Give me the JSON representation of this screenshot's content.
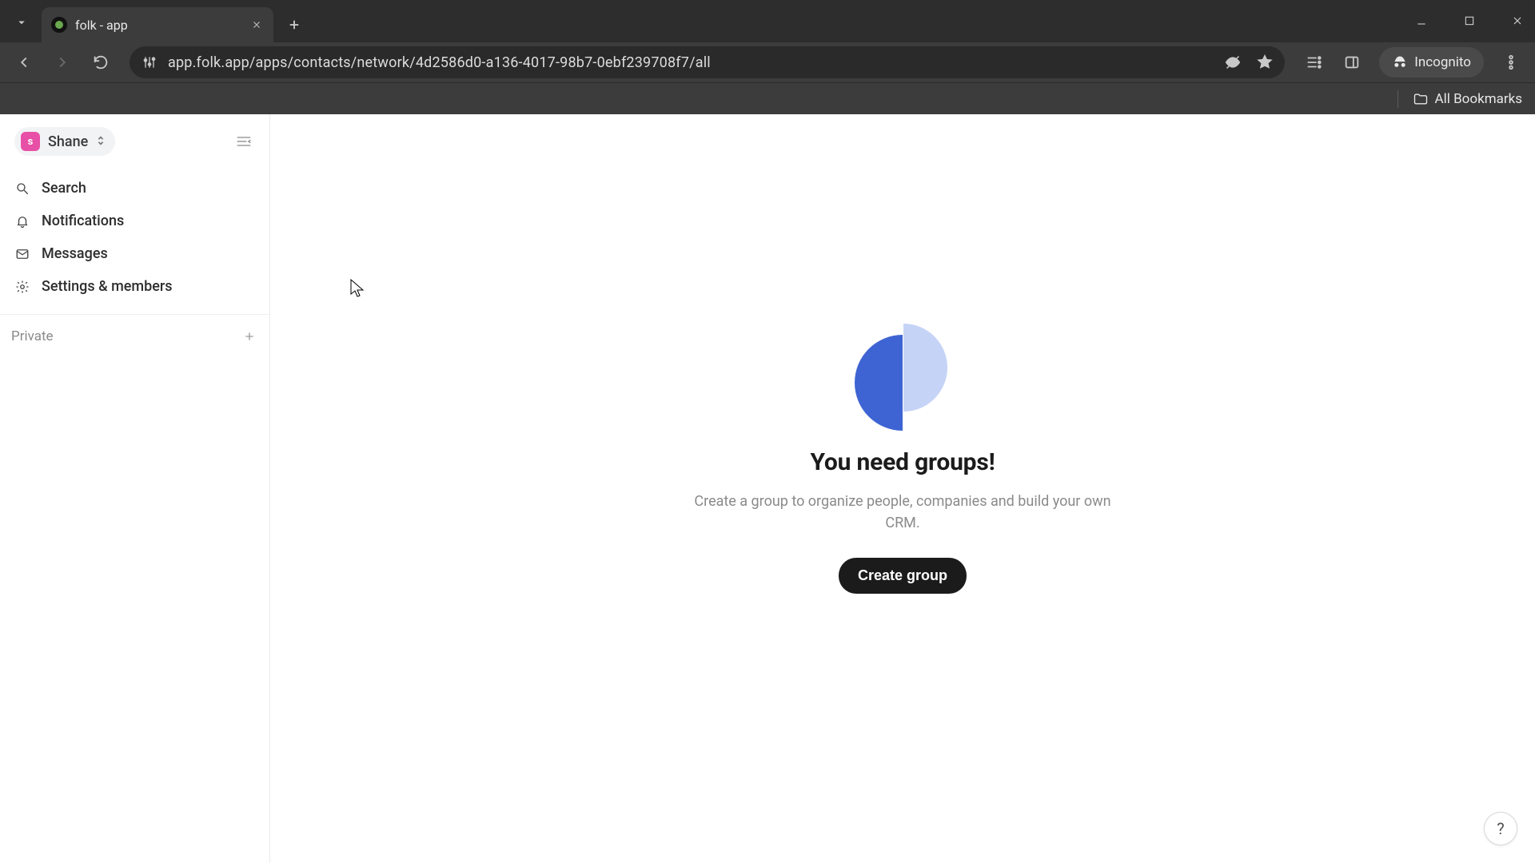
{
  "browser": {
    "tab_title": "folk - app",
    "url": "app.folk.app/apps/contacts/network/4d2586d0-a136-4017-98b7-0ebf239708f7/all",
    "incognito_label": "Incognito",
    "all_bookmarks_label": "All Bookmarks"
  },
  "sidebar": {
    "workspace": {
      "avatar_initial": "s",
      "name": "Shane"
    },
    "nav": {
      "search": "Search",
      "notifications": "Notifications",
      "messages": "Messages",
      "settings": "Settings & members"
    },
    "section_private": "Private"
  },
  "main": {
    "title": "You need groups!",
    "subtitle": "Create a group to organize people, companies and build your own CRM.",
    "cta": "Create group"
  },
  "help": "?"
}
